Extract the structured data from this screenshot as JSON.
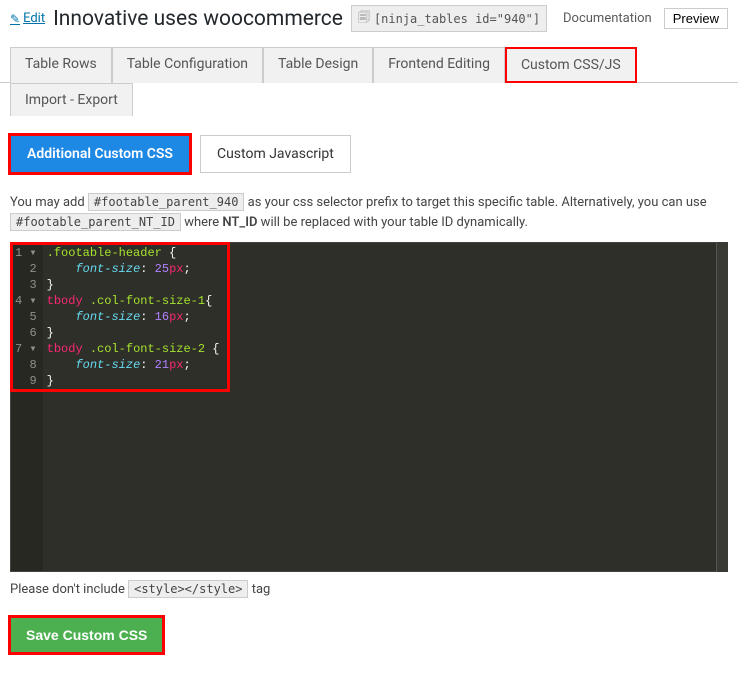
{
  "header": {
    "edit_label": "Edit",
    "title": "Innovative uses woocommerce",
    "shortcode": "[ninja_tables id=\"940\"]",
    "doc_label": "Documentation",
    "preview_label": "Preview"
  },
  "tabs": [
    {
      "label": "Table Rows"
    },
    {
      "label": "Table Configuration"
    },
    {
      "label": "Table Design"
    },
    {
      "label": "Frontend Editing"
    },
    {
      "label": "Custom CSS/JS",
      "active": true,
      "highlight": true
    },
    {
      "label": "Import - Export",
      "row2": true
    }
  ],
  "subtabs": [
    {
      "label": "Additional Custom CSS",
      "active": true,
      "highlight": true
    },
    {
      "label": "Custom Javascript"
    }
  ],
  "help": {
    "prefix": "You may add ",
    "selector1": "#footable_parent_940",
    "mid": " as your css selector prefix to target this specific table. Alternatively, you can use ",
    "selector2": "#footable_parent_NT_ID",
    "mid2": " where ",
    "nt_id": "NT_ID",
    "suffix": " will be replaced with your table ID dynamically."
  },
  "editor": {
    "lines": [
      {
        "n": "1",
        "fold": true,
        "tokens": [
          {
            "c": "tok-sel",
            "t": ".footable-header"
          },
          {
            "c": "tok-punc",
            "t": " {"
          }
        ]
      },
      {
        "n": "2",
        "tokens": [
          {
            "c": "",
            "t": "    "
          },
          {
            "c": "tok-prop",
            "t": "font-size"
          },
          {
            "c": "tok-punc",
            "t": ": "
          },
          {
            "c": "tok-val",
            "t": "25"
          },
          {
            "c": "tok-unit",
            "t": "px"
          },
          {
            "c": "tok-punc",
            "t": ";"
          }
        ]
      },
      {
        "n": "3",
        "tokens": [
          {
            "c": "tok-punc",
            "t": "}"
          }
        ]
      },
      {
        "n": "4",
        "fold": true,
        "tokens": [
          {
            "c": "tok-sel2",
            "t": "tbody"
          },
          {
            "c": "tok-punc",
            "t": " "
          },
          {
            "c": "tok-sel",
            "t": ".col-font-size-1"
          },
          {
            "c": "tok-punc",
            "t": "{"
          }
        ]
      },
      {
        "n": "5",
        "tokens": [
          {
            "c": "",
            "t": "    "
          },
          {
            "c": "tok-prop",
            "t": "font-size"
          },
          {
            "c": "tok-punc",
            "t": ": "
          },
          {
            "c": "tok-val",
            "t": "16"
          },
          {
            "c": "tok-unit",
            "t": "px"
          },
          {
            "c": "tok-punc",
            "t": ";"
          }
        ]
      },
      {
        "n": "6",
        "tokens": [
          {
            "c": "tok-punc",
            "t": "}"
          }
        ]
      },
      {
        "n": "7",
        "fold": true,
        "tokens": [
          {
            "c": "tok-sel2",
            "t": "tbody"
          },
          {
            "c": "tok-punc",
            "t": " "
          },
          {
            "c": "tok-sel",
            "t": ".col-font-size-2"
          },
          {
            "c": "tok-punc",
            "t": " {"
          }
        ]
      },
      {
        "n": "8",
        "tokens": [
          {
            "c": "",
            "t": "    "
          },
          {
            "c": "tok-prop",
            "t": "font-size"
          },
          {
            "c": "tok-punc",
            "t": ": "
          },
          {
            "c": "tok-val",
            "t": "21"
          },
          {
            "c": "tok-unit",
            "t": "px"
          },
          {
            "c": "tok-punc",
            "t": ";"
          }
        ]
      },
      {
        "n": "9",
        "tokens": [
          {
            "c": "tok-punc",
            "t": "}"
          }
        ]
      }
    ]
  },
  "footer_help": {
    "prefix": "Please don't include ",
    "code": "<style></style>",
    "suffix": " tag"
  },
  "save_label": "Save Custom CSS"
}
